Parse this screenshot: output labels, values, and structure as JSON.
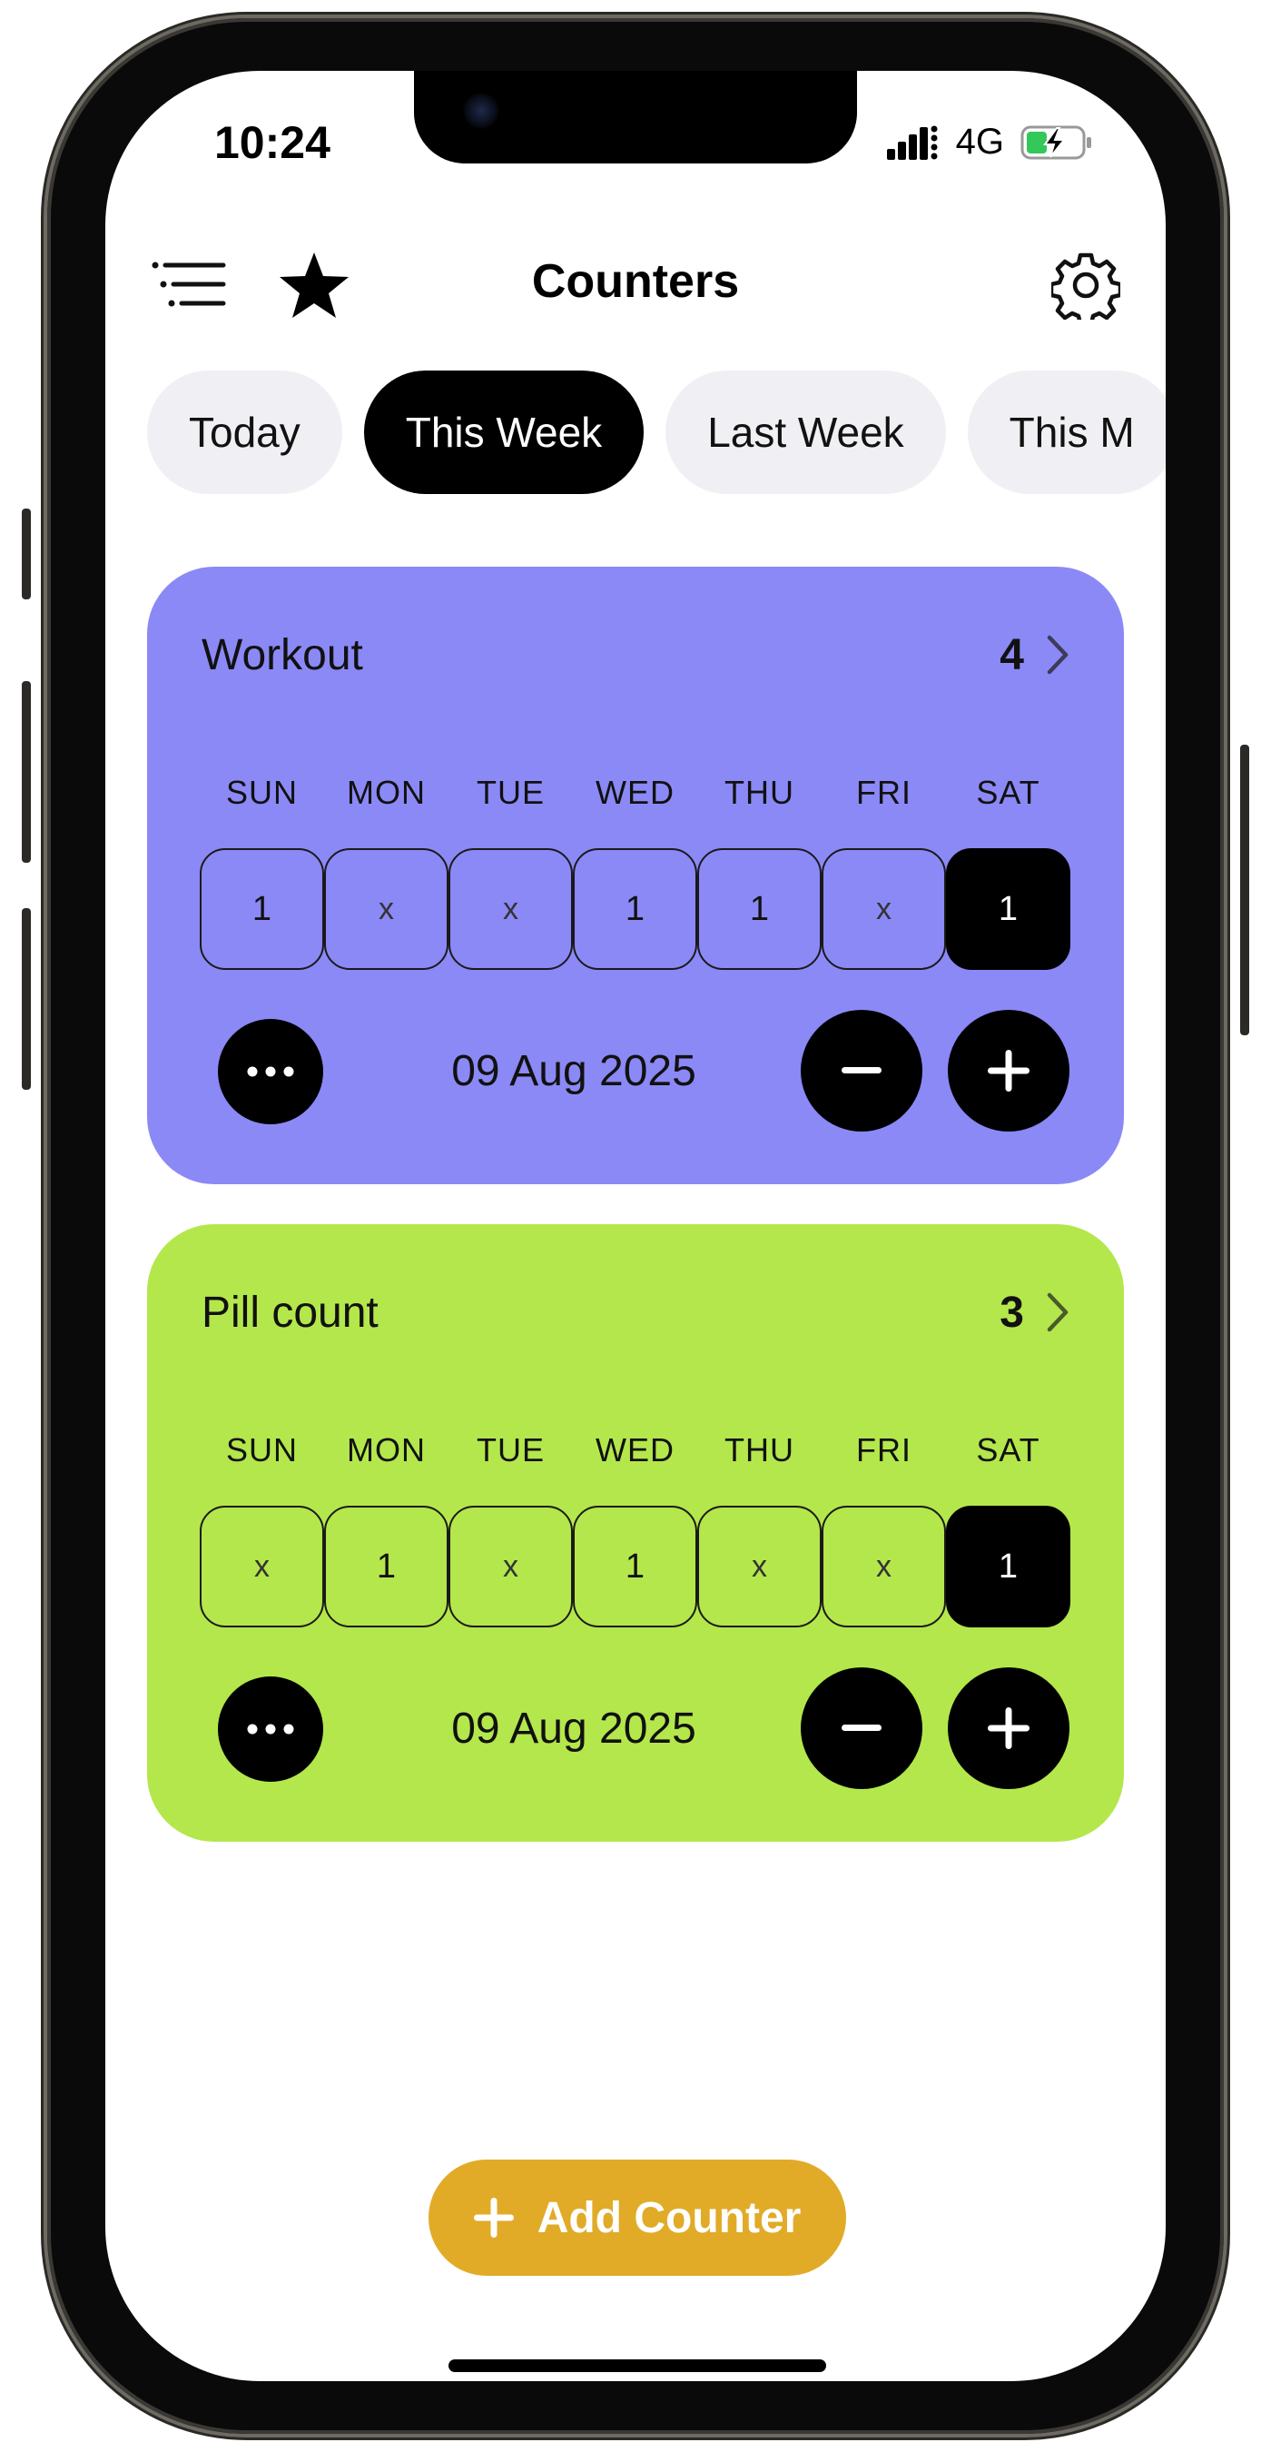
{
  "status_bar": {
    "time": "10:24",
    "network": "4G"
  },
  "header": {
    "title": "Counters"
  },
  "filters": [
    {
      "label": "Today",
      "active": false
    },
    {
      "label": "This Week",
      "active": true
    },
    {
      "label": "Last Week",
      "active": false
    },
    {
      "label": "This M",
      "active": false
    }
  ],
  "colors": {
    "workout_card": "#8b89f6",
    "pill_card": "#b4e74b",
    "add_button": "#e1ab28"
  },
  "counters": [
    {
      "name": "Workout",
      "total": "4",
      "days": [
        "SUN",
        "MON",
        "TUE",
        "WED",
        "THU",
        "FRI",
        "SAT"
      ],
      "values": [
        "1",
        "x",
        "x",
        "1",
        "1",
        "x",
        "1"
      ],
      "date": "09 Aug 2025"
    },
    {
      "name": "Pill count",
      "total": "3",
      "days": [
        "SUN",
        "MON",
        "TUE",
        "WED",
        "THU",
        "FRI",
        "SAT"
      ],
      "values": [
        "x",
        "1",
        "x",
        "1",
        "x",
        "x",
        "1"
      ],
      "date": "09 Aug 2025"
    }
  ],
  "add_button": {
    "label": "Add Counter"
  }
}
